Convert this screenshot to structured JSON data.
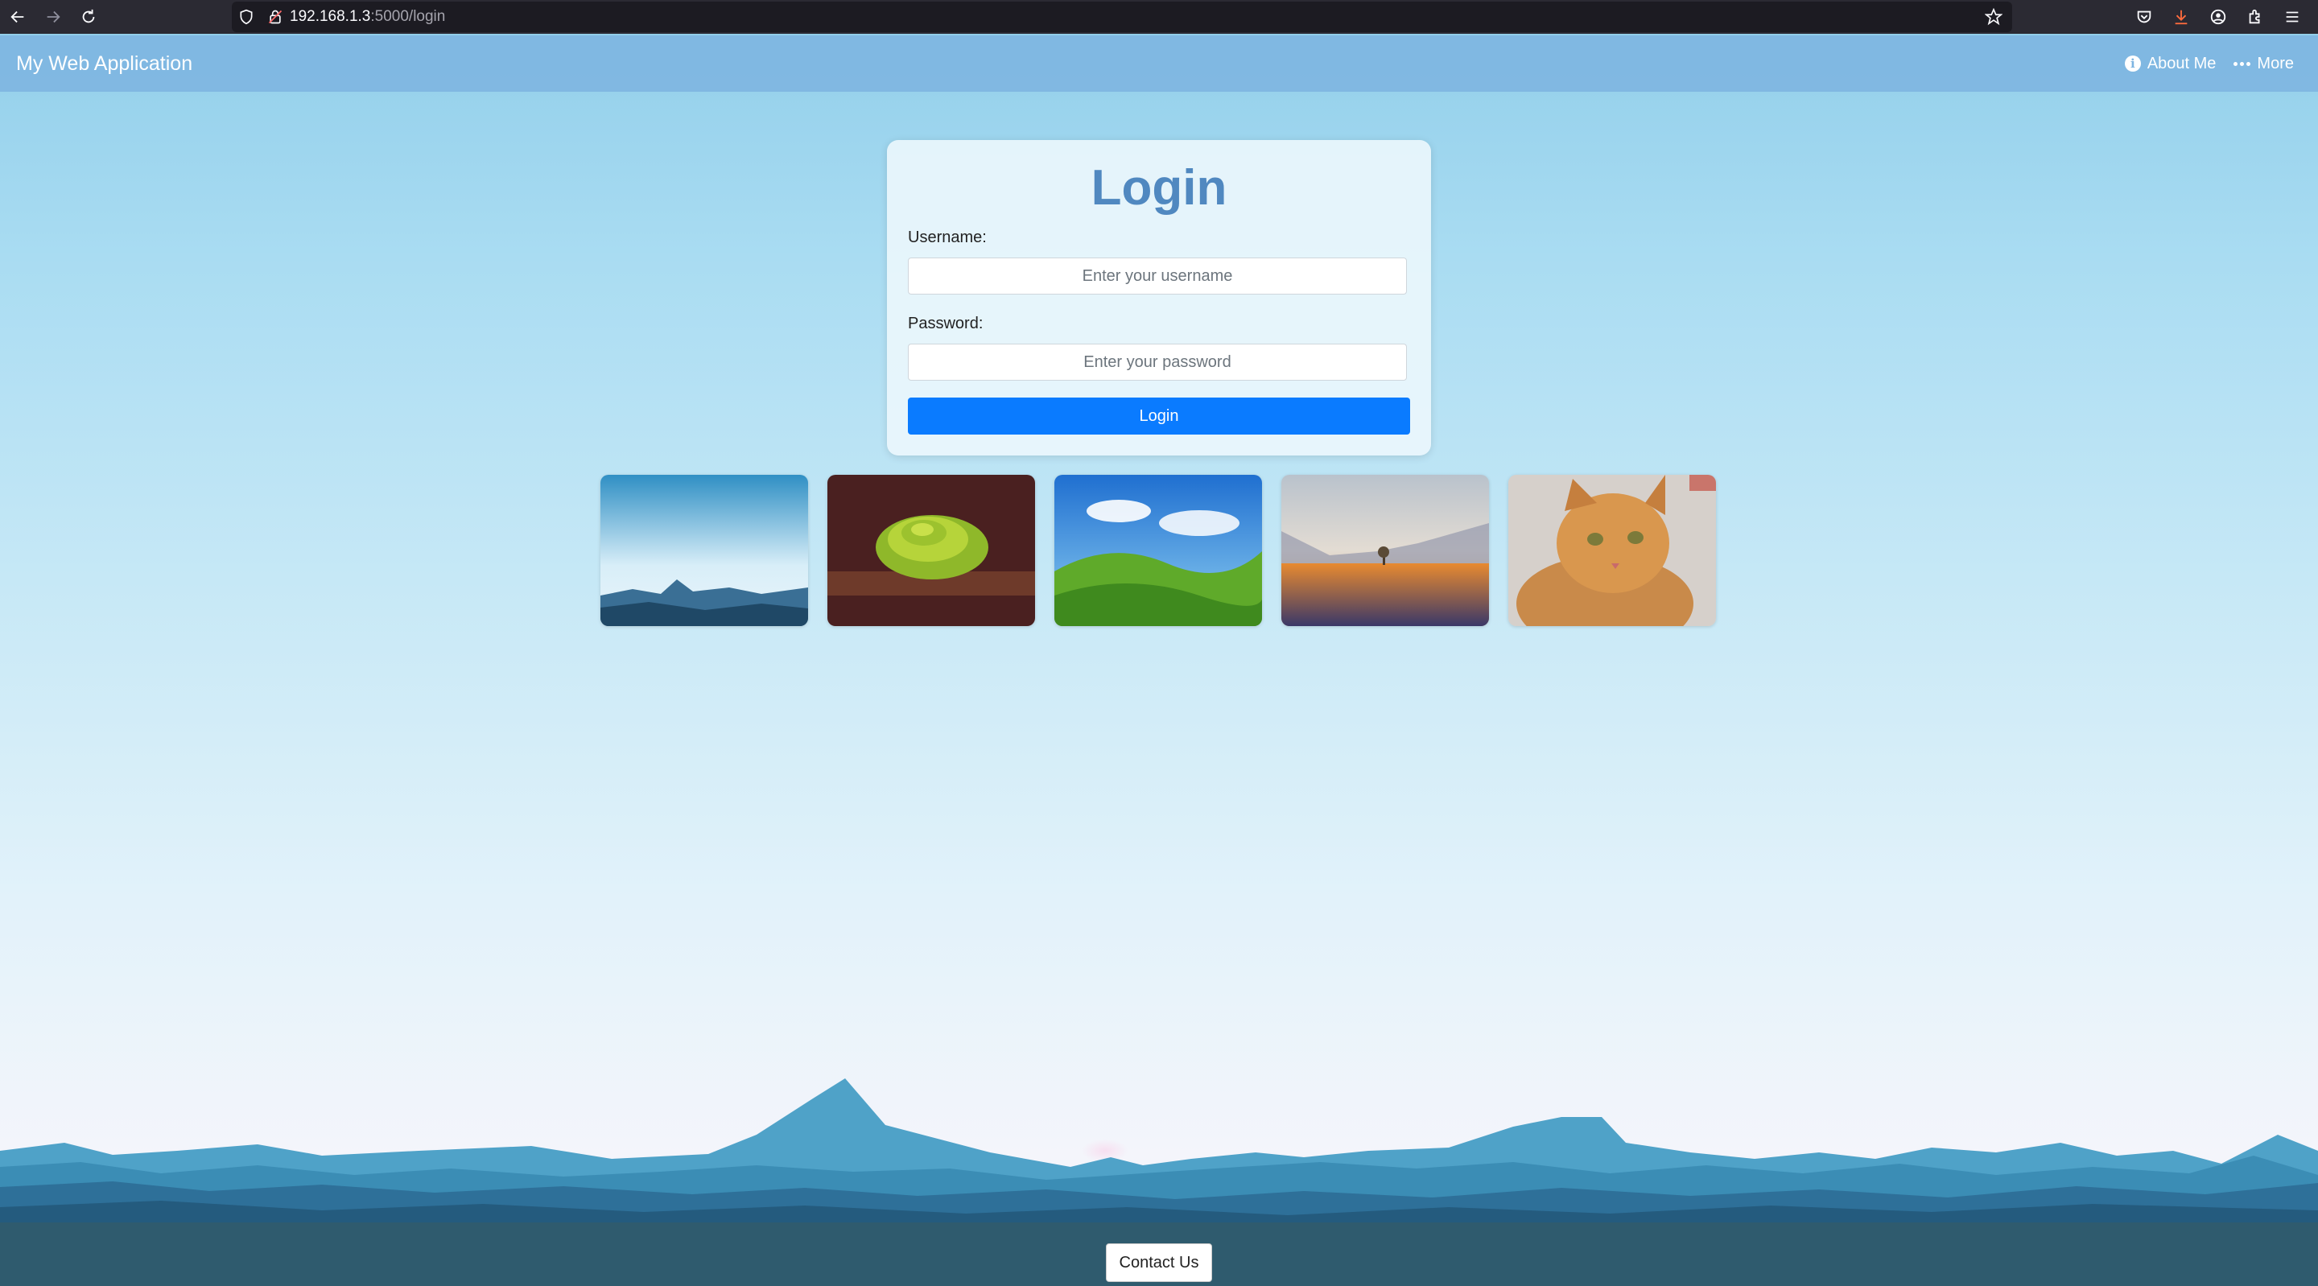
{
  "browser": {
    "url_host": "192.168.1.3",
    "url_path": ":5000/login"
  },
  "navbar": {
    "brand": "My Web Application",
    "about_label": "About Me",
    "more_label": "More"
  },
  "login": {
    "title": "Login",
    "username_label": "Username:",
    "username_placeholder": "Enter your username",
    "password_label": "Password:",
    "password_placeholder": "Enter your password",
    "submit_label": "Login"
  },
  "gallery": {
    "images": [
      {
        "subject": "blue mountain horizon"
      },
      {
        "subject": "green snake on branch"
      },
      {
        "subject": "green hills under blue sky"
      },
      {
        "subject": "orange field with lone tree"
      },
      {
        "subject": "orange tabby cat"
      }
    ]
  },
  "footer": {
    "contact_label": "Contact Us"
  },
  "colors": {
    "accent": "#0a7bff",
    "title": "#5088c0",
    "navbar": "#7db4e1",
    "footer": "#2f5b6e"
  }
}
